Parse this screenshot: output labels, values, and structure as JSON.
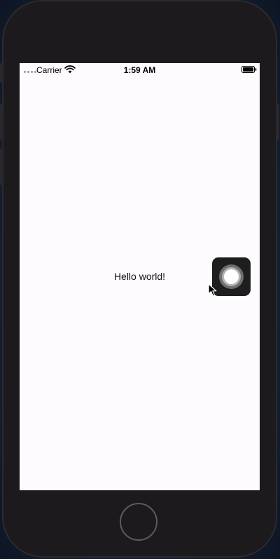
{
  "status_bar": {
    "carrier": "Carrier",
    "time": "1:59 AM",
    "icons": [
      "signal-icon",
      "wifi-icon",
      "battery-icon"
    ]
  },
  "main": {
    "text": "Hello world!"
  },
  "assistive_touch": {
    "icon": "assistive-touch-icon"
  },
  "device": {
    "home_button_icon": "home-button-icon"
  },
  "colors": {
    "screen_background": "#fdfbfe",
    "device_bezel": "#1c1a1d",
    "assistive_background": "#1e1e1f"
  }
}
